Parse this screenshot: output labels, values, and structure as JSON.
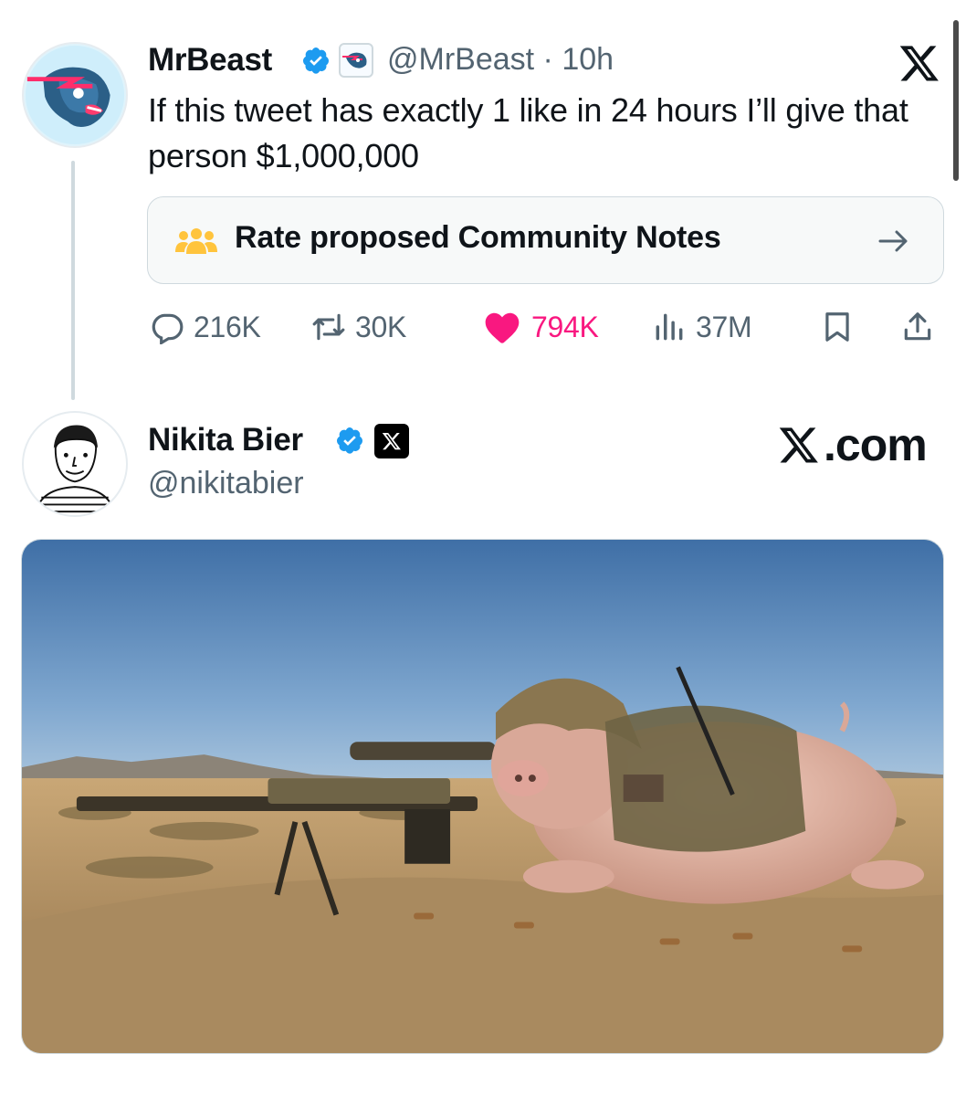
{
  "tweet": {
    "author_name": "MrBeast",
    "handle": "@MrBeast",
    "time": "10h",
    "text": "If this tweet has exactly 1 like in 24 hours I’ll give that person $1,000,000",
    "community_notes_label": "Rate proposed Community Notes",
    "actions": {
      "replies": "216K",
      "retweets": "30K",
      "likes": "794K",
      "views": "37M"
    }
  },
  "reply": {
    "author_name": "Nikita Bier",
    "handle": "@nikitabier",
    "affiliation_label": "X.com",
    "media_icon": "image-of-pig-sniper-in-desert"
  },
  "colors": {
    "like_pink": "#f91880",
    "verified_blue": "#1d9bf0",
    "muted_text": "#536471"
  },
  "icons": [
    "verified-badge-icon",
    "x-logo-icon",
    "community-notes-icon",
    "arrow-right-icon",
    "reply-icon",
    "retweet-icon",
    "like-icon",
    "views-icon",
    "bookmark-icon",
    "share-icon"
  ]
}
